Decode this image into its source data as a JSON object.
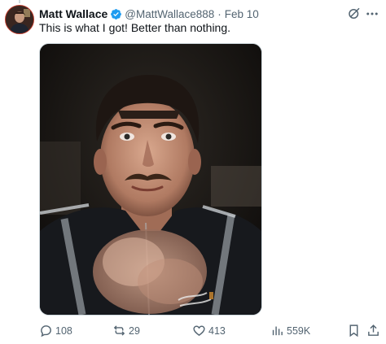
{
  "tweet": {
    "author_name": "Matt Wallace",
    "handle": "@MattWallace888",
    "separator": "·",
    "date": "Feb 10",
    "text": "This is what I got! Better than nothing."
  },
  "actions": {
    "replies": "108",
    "retweets": "29",
    "likes": "413",
    "views": "559K"
  },
  "colors": {
    "verified_badge": "#1d9bf0",
    "secondary_text": "#536471",
    "primary_text": "#0f1419"
  },
  "icons": [
    "grok-icon",
    "more-icon",
    "reply-icon",
    "retweet-icon",
    "like-icon",
    "views-icon",
    "bookmark-icon",
    "share-icon",
    "verified-badge-icon"
  ]
}
